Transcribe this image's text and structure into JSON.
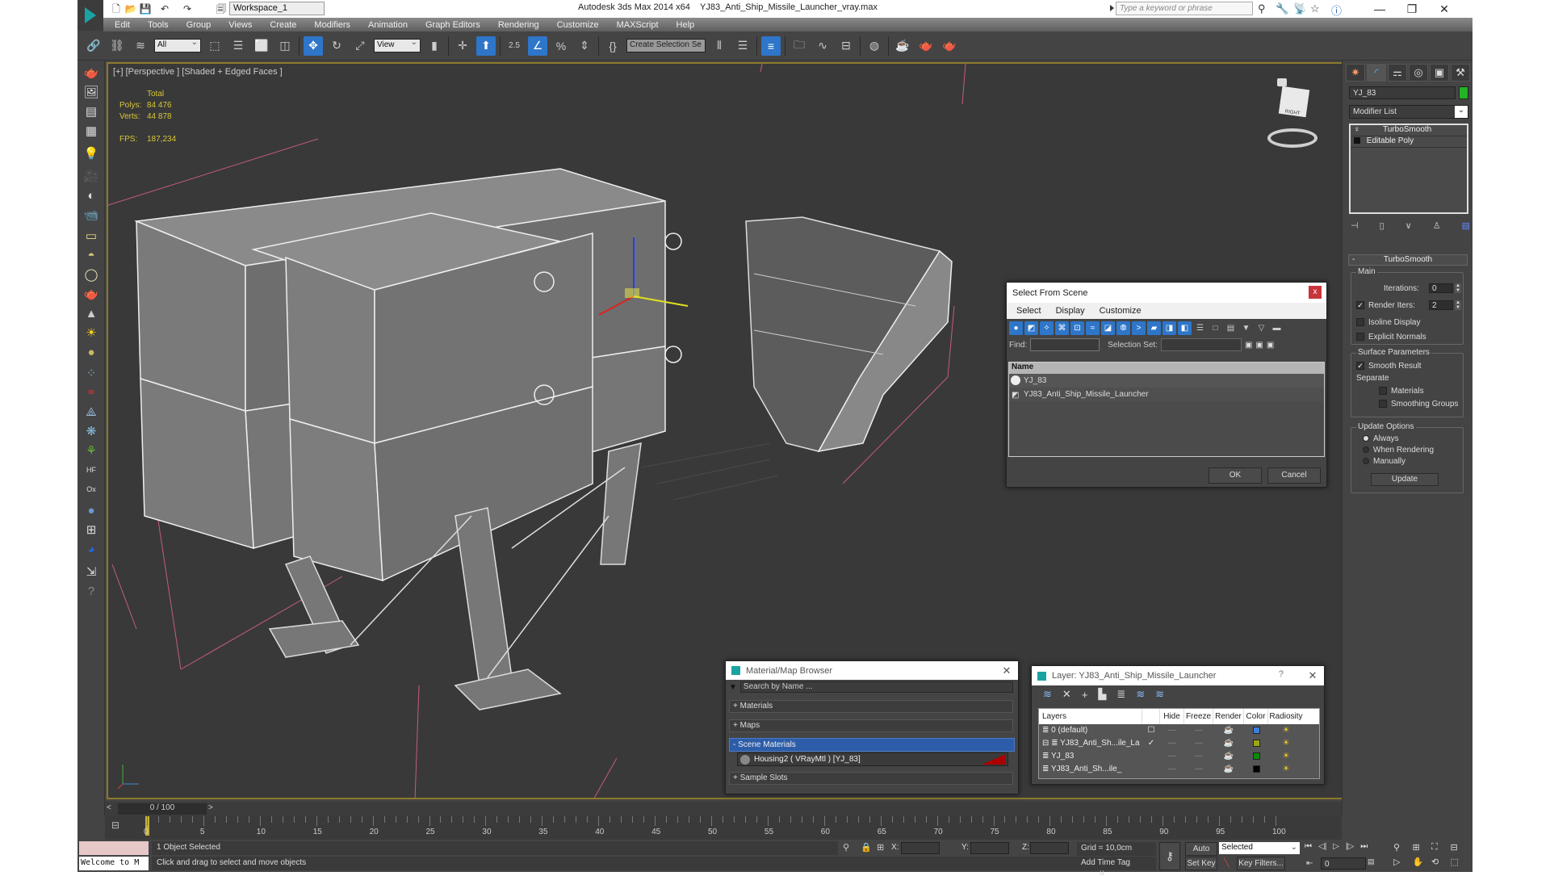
{
  "titlebar": {
    "workspace": "Workspace_1",
    "app_title": "Autodesk 3ds Max  2014 x64",
    "file_name": "YJ83_Anti_Ship_Missile_Launcher_vray.max",
    "search_placeholder": "Type a keyword or phrase",
    "minimize": "—",
    "restore": "❐",
    "close": "✕"
  },
  "menu": [
    "Edit",
    "Tools",
    "Group",
    "Views",
    "Create",
    "Modifiers",
    "Animation",
    "Graph Editors",
    "Rendering",
    "Customize",
    "MAXScript",
    "Help"
  ],
  "toolbar": {
    "selection_filter": "All",
    "reference_coord": "View",
    "snap_value": "2.5",
    "named_selection_placeholder": "Create Selection Se"
  },
  "viewport": {
    "label": "[+] [Perspective ] [Shaded + Edged Faces ]",
    "stats": {
      "header": "Total",
      "polys_label": "Polys:",
      "polys": "84 476",
      "verts_label": "Verts:",
      "verts": "44 878",
      "fps_label": "FPS:",
      "fps": "187,234"
    },
    "viewcube_face": "RIGHT"
  },
  "command_panel": {
    "object_name": "YJ_83",
    "object_color": "#22b422",
    "modifier_list": "Modifier List",
    "stack": [
      {
        "name": "TurboSmooth",
        "icon": "bulb-icon"
      },
      {
        "name": "Editable Poly",
        "icon": "expand-icon"
      }
    ],
    "rollout_title": "TurboSmooth",
    "main_group": "Main",
    "iterations_label": "Iterations:",
    "iterations": "0",
    "render_iters_label": "Render Iters:",
    "render_iters": "2",
    "render_iters_checked": true,
    "isoline_display": "Isoline Display",
    "explicit_normals": "Explicit Normals",
    "surface_group": "Surface Parameters",
    "smooth_result": "Smooth Result",
    "separate_label": "Separate",
    "materials": "Materials",
    "smoothing_groups": "Smoothing Groups",
    "update_group": "Update Options",
    "update_always": "Always",
    "update_rendering": "When Rendering",
    "update_manually": "Manually",
    "update_button": "Update"
  },
  "select_from_scene": {
    "title": "Select From Scene",
    "menu": [
      "Select",
      "Display",
      "Customize"
    ],
    "find_label": "Find:",
    "selection_set_label": "Selection Set:",
    "column_name": "Name",
    "items": [
      "YJ_83",
      "YJ83_Anti_Ship_Missile_Launcher"
    ],
    "ok": "OK",
    "cancel": "Cancel",
    "close": "x"
  },
  "material_browser": {
    "title": "Material/Map Browser",
    "search_placeholder": "Search by Name ...",
    "groups": [
      "+ Materials",
      "+ Maps",
      "- Scene Materials",
      "+ Sample Slots"
    ],
    "scene_material": "Housing2  ( VRayMtl )  [YJ_83]"
  },
  "layer_dialog": {
    "title": "Layer: YJ83_Anti_Ship_Missile_Launcher",
    "help": "?",
    "close": "✕",
    "columns": [
      "Layers",
      "",
      "Hide",
      "Freeze",
      "Render",
      "Color",
      "Radiosity"
    ],
    "rows": [
      {
        "name": "0 (default)",
        "indent": 1,
        "current": "☐",
        "color": "#3a7fe0"
      },
      {
        "name": "YJ83_Anti_Sh...ile_La",
        "indent": 0,
        "current": "✓",
        "color": "#9aa814"
      },
      {
        "name": "YJ_83",
        "indent": 2,
        "current": "",
        "color": "#0a8a0a"
      },
      {
        "name": "YJ83_Anti_Sh...ile_",
        "indent": 2,
        "current": "",
        "color": "#000000"
      }
    ]
  },
  "timeline": {
    "frame_display": "0 / 100",
    "ticks": [
      "0",
      "5",
      "10",
      "15",
      "20",
      "25",
      "30",
      "35",
      "40",
      "45",
      "50",
      "55",
      "60",
      "65",
      "70",
      "75",
      "80",
      "85",
      "90",
      "95",
      "100"
    ]
  },
  "status": {
    "maxscript_listener": "Welcome to M",
    "selection": "1 Object Selected",
    "prompt": "Click and drag to select and move objects",
    "x_label": "X:",
    "y_label": "Y:",
    "z_label": "Z:",
    "grid": "Grid = 10,0cm",
    "add_time_tag": "Add Time Tag",
    "auto_key": "Auto Key",
    "set_key": "Set Key",
    "key_mode": "Selected",
    "key_filters": "Key Filters...",
    "current_frame": "0"
  }
}
